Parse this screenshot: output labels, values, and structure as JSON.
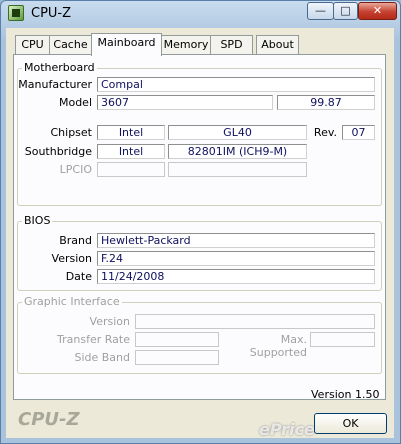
{
  "window": {
    "title": "CPU-Z",
    "minimize_glyph": "—",
    "maximize_glyph": "□",
    "close_glyph": "✕"
  },
  "tabs": [
    {
      "label": "CPU",
      "active": false
    },
    {
      "label": "Cache",
      "active": false
    },
    {
      "label": "Mainboard",
      "active": true
    },
    {
      "label": "Memory",
      "active": false
    },
    {
      "label": "SPD",
      "active": false
    },
    {
      "label": "About",
      "active": false
    }
  ],
  "motherboard": {
    "legend": "Motherboard",
    "manufacturer_label": "Manufacturer",
    "manufacturer": "Compal",
    "model_label": "Model",
    "model": "3607",
    "model_rev": "99.87",
    "chipset_label": "Chipset",
    "chipset_vendor": "Intel",
    "chipset_name": "GL40",
    "rev_label": "Rev.",
    "rev": "07",
    "southbridge_label": "Southbridge",
    "southbridge_vendor": "Intel",
    "southbridge_name": "82801IM (ICH9-M)",
    "lpcio_label": "LPCIO",
    "lpcio_vendor": "",
    "lpcio_name": ""
  },
  "bios": {
    "legend": "BIOS",
    "brand_label": "Brand",
    "brand": "Hewlett-Packard",
    "version_label": "Version",
    "version": "F.24",
    "date_label": "Date",
    "date": "11/24/2008"
  },
  "graphic": {
    "legend": "Graphic Interface",
    "version_label": "Version",
    "version": "",
    "transfer_rate_label": "Transfer Rate",
    "transfer_rate": "",
    "max_supported_label": "Max. Supported",
    "max_supported": "",
    "side_band_label": "Side Band",
    "side_band": ""
  },
  "footer": {
    "version_text": "Version 1.50",
    "brand": "CPU-Z",
    "ok_label": "OK",
    "watermark": "ePrice"
  },
  "colors": {
    "title_bar": "#b3cbe3",
    "close_button": "#c54130",
    "field_text": "#101060",
    "dialog_bg": "#ece9d8"
  }
}
